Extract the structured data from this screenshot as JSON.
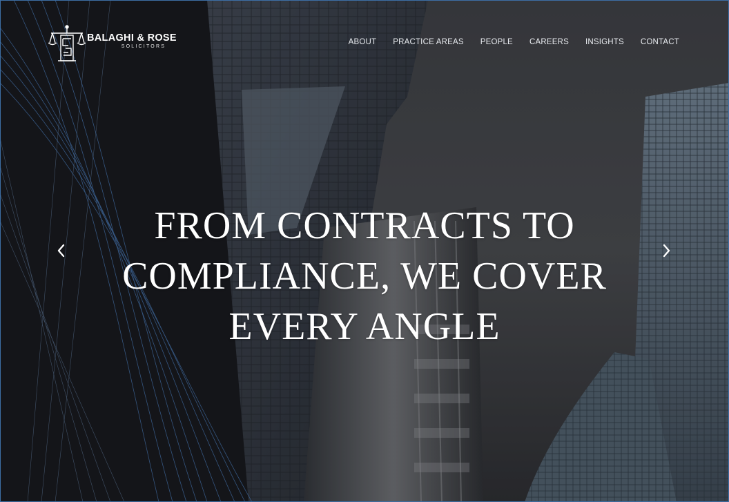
{
  "brand": {
    "name": "BALAGHI & ROSE",
    "tagline": "SOLICITORS"
  },
  "nav": {
    "items": [
      {
        "label": "ABOUT"
      },
      {
        "label": "PRACTICE AREAS"
      },
      {
        "label": "PEOPLE"
      },
      {
        "label": "CAREERS"
      },
      {
        "label": "INSIGHTS"
      },
      {
        "label": "CONTACT"
      }
    ]
  },
  "hero": {
    "headline_lines": [
      "FROM CONTRACTS TO",
      "COMPLIANCE, WE COVER",
      "EVERY ANGLE"
    ],
    "prev_icon": "chevron-left-icon",
    "next_icon": "chevron-right-icon"
  },
  "colors": {
    "text": "#ffffff",
    "accent_lines": "#4a7fc0",
    "frame": "#3d6fa6"
  }
}
